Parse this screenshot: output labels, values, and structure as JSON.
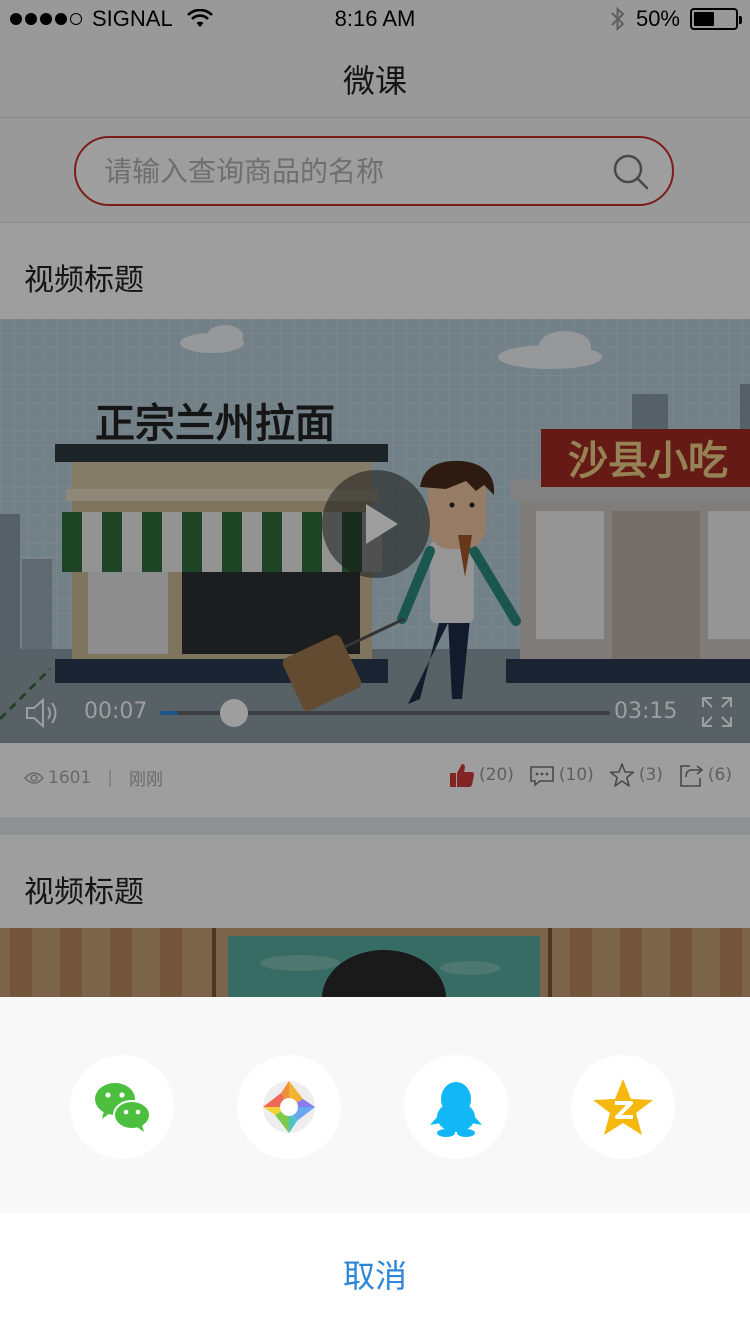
{
  "status_bar": {
    "carrier": "SIGNAL",
    "time": "8:16 AM",
    "battery_text": "50%",
    "battery_level": 0.5,
    "signal_dots_filled": 4,
    "signal_dots_total": 5
  },
  "nav": {
    "title": "微课"
  },
  "search": {
    "placeholder": "请输入查询商品的名称",
    "value": ""
  },
  "feed": [
    {
      "title": "视频标题",
      "video": {
        "sign_left": "正宗兰州拉面",
        "sign_right": "沙县小吃",
        "current_time": "00:07",
        "total_time": "03:15",
        "progress": 0.04
      },
      "meta": {
        "views": "1601",
        "posted": "刚刚",
        "likes": "(20)",
        "comments": "(10)",
        "favorites": "(3)",
        "shares": "(6)"
      }
    },
    {
      "title": "视频标题"
    }
  ],
  "share_sheet": {
    "targets": [
      "wechat-icon",
      "moments-icon",
      "qq-icon",
      "qzone-icon"
    ],
    "cancel_label": "取消"
  },
  "colors": {
    "accent": "#c8302b",
    "link_blue": "#2e86d8",
    "like_red": "#d23a3a"
  }
}
